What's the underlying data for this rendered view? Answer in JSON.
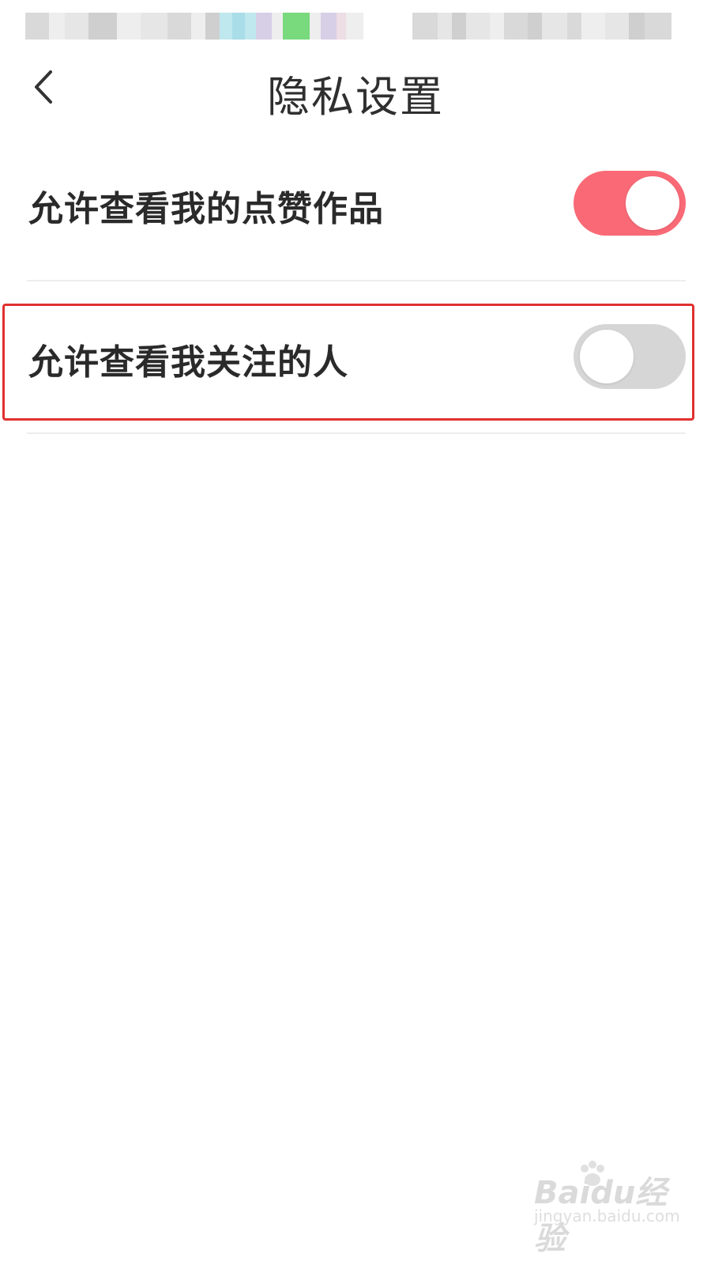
{
  "header": {
    "title": "隐私设置"
  },
  "settings": [
    {
      "label": "允许查看我的点赞作品",
      "enabled": true
    },
    {
      "label": "允许查看我关注的人",
      "enabled": false
    }
  ],
  "colors": {
    "toggle_on": "#f96a76",
    "toggle_off": "#d6d6d6",
    "highlight": "#e0312f"
  },
  "icons": {
    "back": "chevron-left-icon"
  },
  "watermark": {
    "logo": "Baidu经验",
    "url": "jingyan.baidu.com"
  }
}
